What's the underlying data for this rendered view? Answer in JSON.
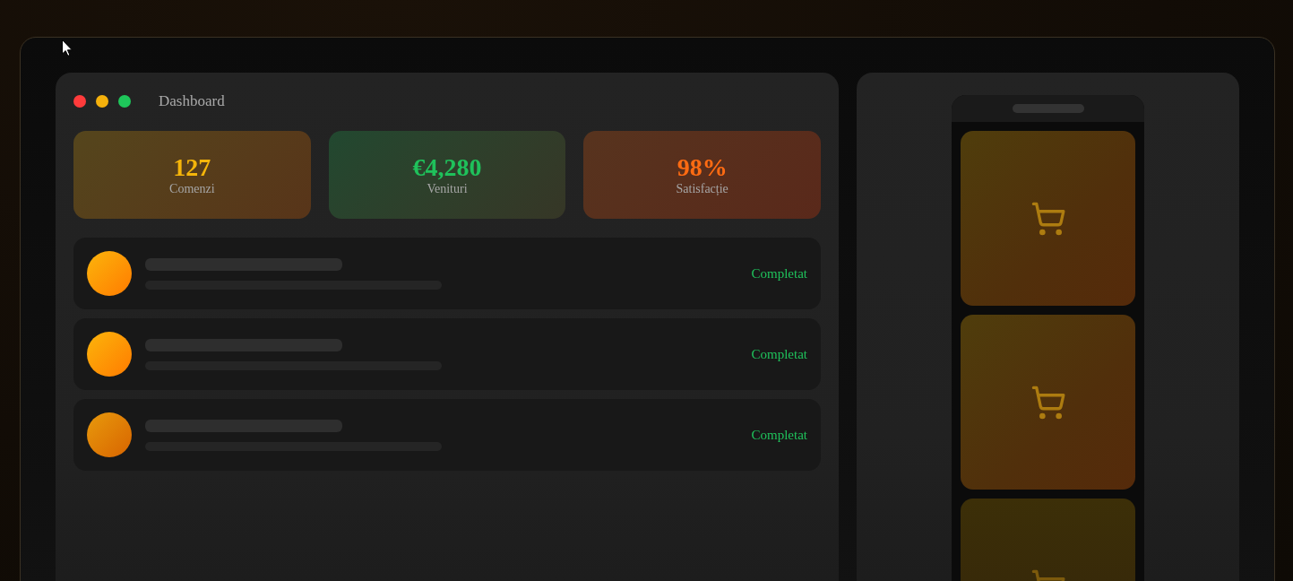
{
  "window": {
    "title": "Dashboard"
  },
  "stats": [
    {
      "value": "127",
      "label": "Comenzi",
      "color": "#f5b50a"
    },
    {
      "value": "€4,280",
      "label": "Venituri",
      "color": "#1fc15b"
    },
    {
      "value": "98%",
      "label": "Satisfacție",
      "color": "#ff6b12"
    }
  ],
  "orders": [
    {
      "status": "Completat"
    },
    {
      "status": "Completat"
    },
    {
      "status": "Completat"
    }
  ]
}
